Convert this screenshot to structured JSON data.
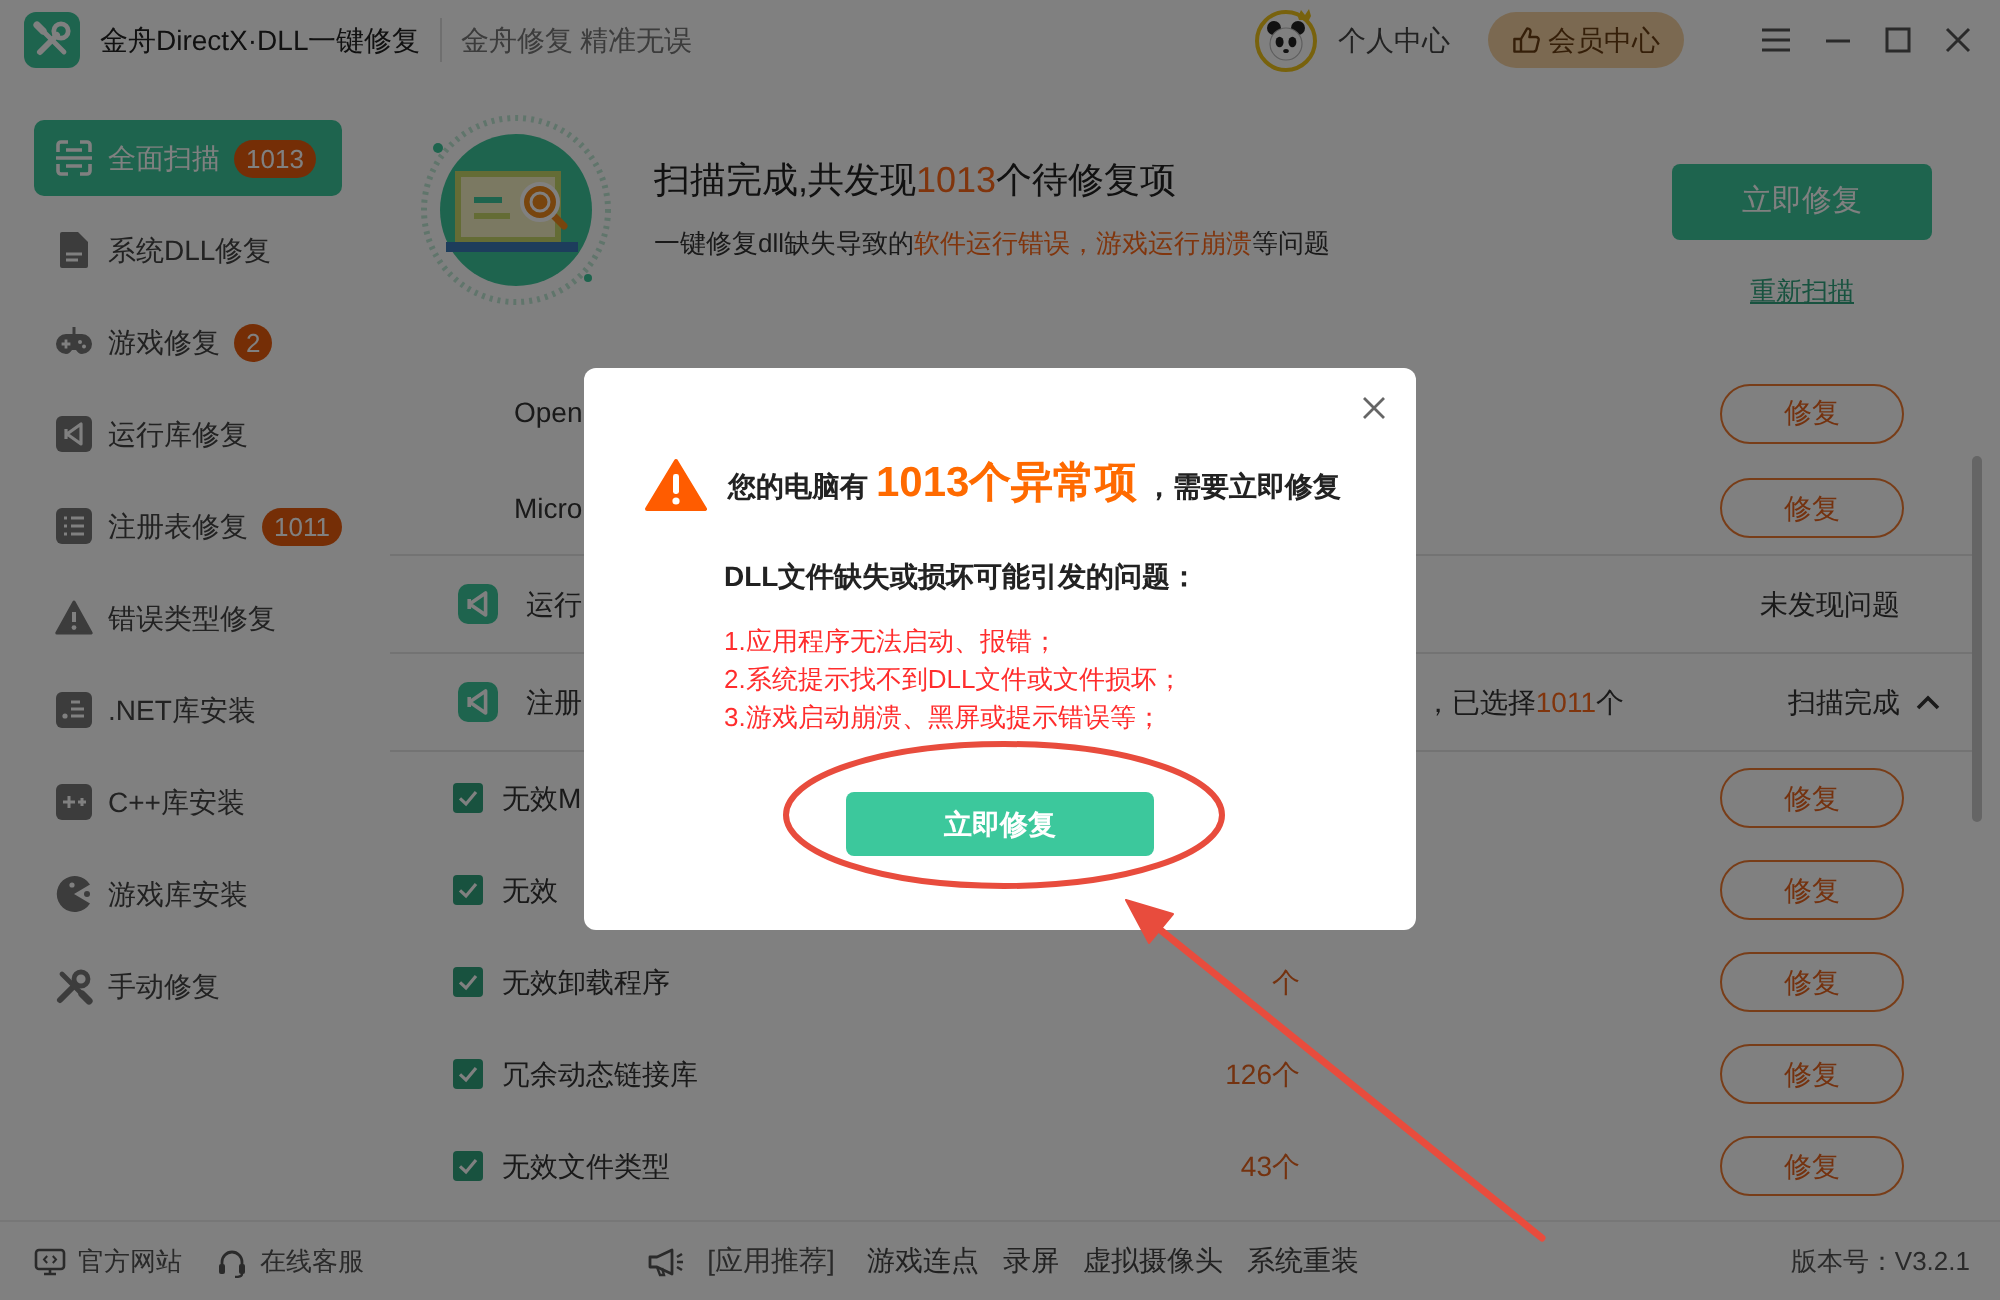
{
  "window": {
    "title": "金舟DirectX·DLL一键修复",
    "slogan": "金舟修复 精准无误",
    "user_center": "个人中心",
    "member_center": "会员中心"
  },
  "sidebar": {
    "items": [
      {
        "label": "全面扫描",
        "badge": "1013",
        "selected": true
      },
      {
        "label": "系统DLL修复",
        "selected": false
      },
      {
        "label": "游戏修复",
        "badge": "2",
        "selected": false
      },
      {
        "label": "运行库修复",
        "selected": false
      },
      {
        "label": "注册表修复",
        "badge": "1011",
        "selected": false
      },
      {
        "label": "错误类型修复",
        "selected": false
      },
      {
        "label": ".NET库安装",
        "selected": false
      },
      {
        "label": "C++库安装",
        "selected": false
      },
      {
        "label": "游戏库安装",
        "selected": false
      },
      {
        "label": "手动修复",
        "selected": false
      }
    ]
  },
  "summary": {
    "title": [
      {
        "text": "扫描完成,共发现",
        "highlight": false
      },
      {
        "text": "1013",
        "highlight": true
      },
      {
        "text": "个待修复项",
        "highlight": false
      }
    ],
    "subtitle": [
      {
        "text": "一键修复dll缺失导致的",
        "highlight": false
      },
      {
        "text": "软件运行错误，游戏运行崩溃",
        "highlight": true
      },
      {
        "text": "等问题",
        "highlight": false
      }
    ],
    "fix_button": "立即修复",
    "rescan_link": "重新扫描"
  },
  "results": [
    {
      "kind": "entry",
      "name": "Open",
      "action": "修复"
    },
    {
      "kind": "entry",
      "name": "Micro",
      "action": "修复"
    },
    {
      "kind": "category",
      "name": "运行",
      "status": "未发现问题"
    },
    {
      "kind": "category",
      "name": "注册",
      "note": [
        {
          "text": "，已选择",
          "highlight": false
        },
        {
          "text": "1011",
          "highlight": true
        },
        {
          "text": "个",
          "highlight": false
        }
      ],
      "status": "扫描完成",
      "expanded": true
    },
    {
      "kind": "check",
      "name": "无效M",
      "checked": true,
      "action": "修复"
    },
    {
      "kind": "check",
      "name": "无效",
      "checked": true,
      "action": "修复"
    },
    {
      "kind": "check",
      "name": "无效卸载程序",
      "count": "个",
      "checked": true,
      "action": "修复"
    },
    {
      "kind": "check",
      "name": "冗余动态链接库",
      "count": "126个",
      "checked": true,
      "action": "修复"
    },
    {
      "kind": "check",
      "name": "无效文件类型",
      "count": "43个",
      "checked": true,
      "action": "修复"
    }
  ],
  "dialog": {
    "headline": [
      {
        "text": "您的电脑有",
        "highlight": false
      },
      {
        "text": "1013个异常项",
        "highlight": true
      },
      {
        "text": "，需要立即修复",
        "highlight": false
      }
    ],
    "question": "DLL文件缺失或损坏可能引发的问题：",
    "problems": [
      "1.应用程序无法启动、报错；",
      "2.系统提示找不到DLL文件或文件损坏；",
      "3.游戏启动崩溃、黑屏或提示错误等；"
    ],
    "button": "立即修复"
  },
  "status_bar": {
    "links": [
      "官方网站",
      "在线客服"
    ],
    "recommend_label": "[应用推荐]",
    "apps": [
      "游戏连点",
      "录屏",
      "虚拟摄像头",
      "系统重装"
    ],
    "version": "版本号：V3.2.1"
  },
  "annotations": {
    "circle_around_button": true,
    "arrow_to_button": true
  }
}
